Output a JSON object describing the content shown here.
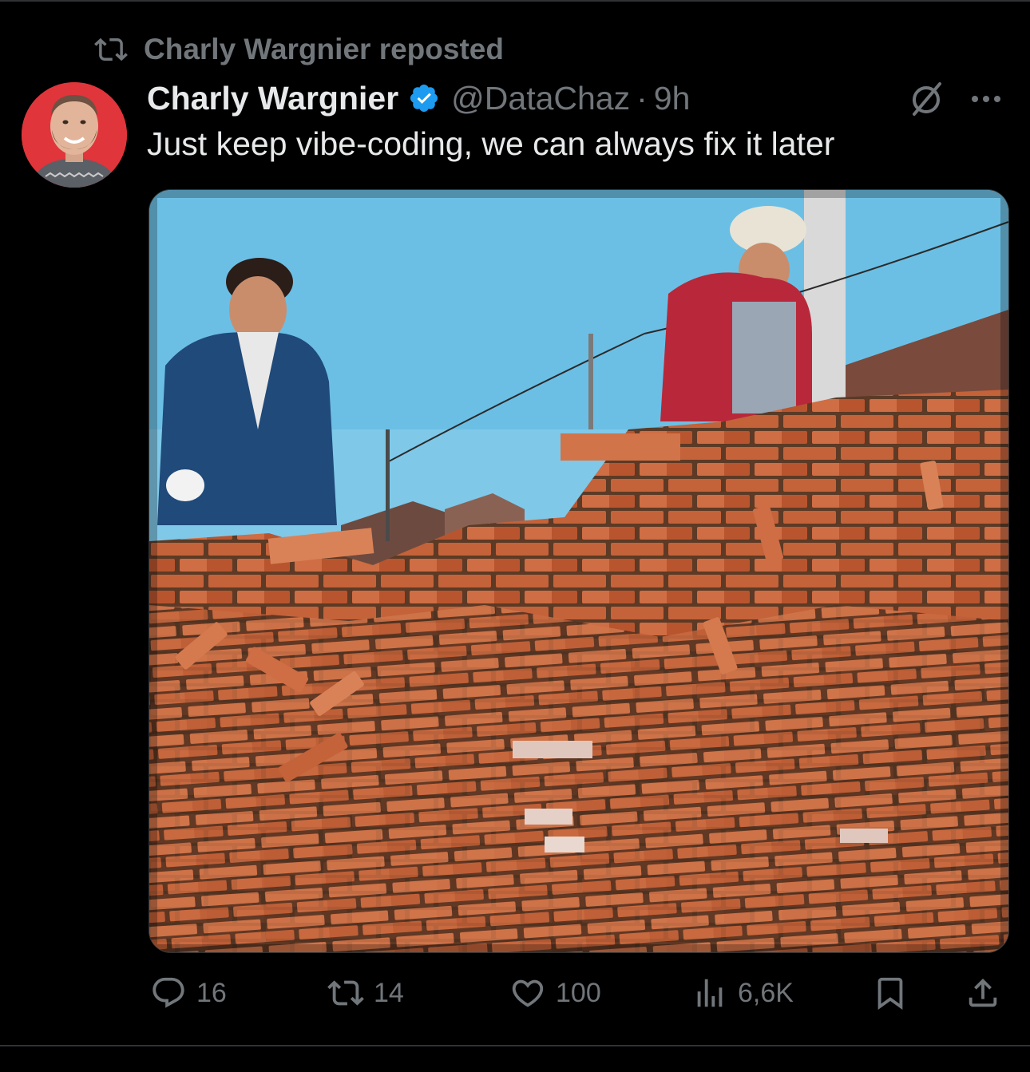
{
  "repost": {
    "label": "Charly Wargnier reposted",
    "icon": "repost-icon"
  },
  "post": {
    "author_name": "Charly Wargnier",
    "handle": "@DataChaz",
    "separator": "·",
    "time": "9h",
    "verified": true,
    "text": "Just keep vibe-coding, we can always fix it later",
    "media_description_icon": "photo",
    "accent": "#1d9bf0"
  },
  "actions": {
    "replies": "16",
    "reposts": "14",
    "likes": "100",
    "views": "6,6K"
  },
  "colors": {
    "background": "#000000",
    "muted": "#71767b",
    "text": "#e7e9ea",
    "verified": "#1d9bf0"
  }
}
